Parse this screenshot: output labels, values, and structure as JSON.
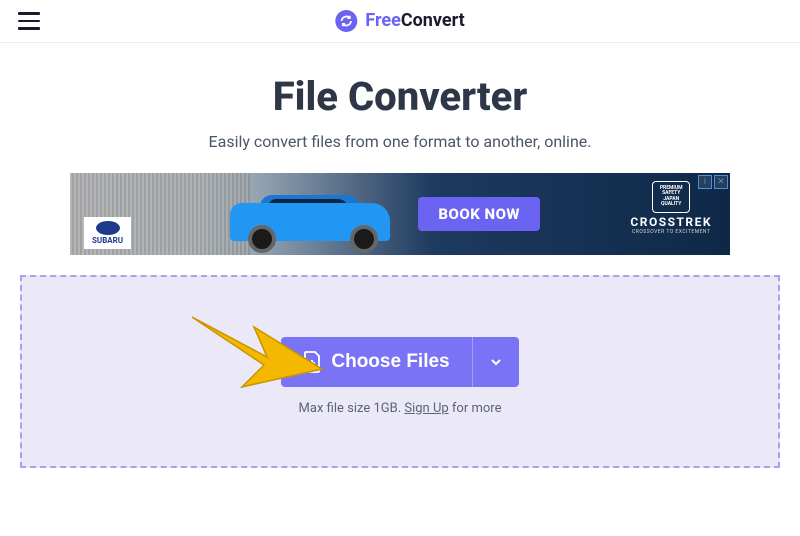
{
  "header": {
    "brand_free": "Free",
    "brand_convert": "Convert"
  },
  "main": {
    "title": "File Converter",
    "subtitle": "Easily convert files from one format to another, online."
  },
  "ad": {
    "subaru_label": "SUBARU",
    "cta": "BOOK NOW",
    "seal_line1": "PREMIUM",
    "seal_line2": "SAFETY",
    "seal_line3": "JAPAN",
    "seal_line4": "QUALITY",
    "model": "CROSSTREK",
    "tagline": "CROSSOVER TO EXCITEMENT"
  },
  "dropzone": {
    "choose_label": "Choose Files",
    "info_prefix": "Max file size 1GB. ",
    "info_link": "Sign Up",
    "info_suffix": " for more"
  }
}
